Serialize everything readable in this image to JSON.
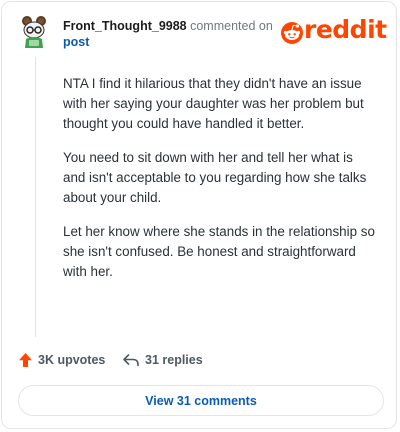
{
  "header": {
    "username": "Front_Thought_9988",
    "commented_on": "commented on",
    "post_link": "post",
    "brand": "reddit"
  },
  "comment": {
    "paragraphs": [
      "NTA I find it hilarious that they didn't have an issue with her saying your daughter was her problem but thought you could have handled it better.",
      "You need to sit down with her and tell her what is and isn't acceptable to you regarding how she talks about your child.",
      "Let her know where she stands in the relationship so she isn't confused. Be honest and straightforward with her."
    ]
  },
  "actions": {
    "upvotes": "3K upvotes",
    "replies": "31 replies",
    "view_comments": "View 31 comments"
  },
  "colors": {
    "brand": "#ff4500",
    "link": "#0b5bb5",
    "upvote_icon": "#ff4500",
    "meta_text": "#6f7a80"
  },
  "icons": {
    "upvote": "upvote-arrow-icon",
    "reply": "reply-arrow-icon",
    "brand": "reddit-snoo-icon"
  }
}
